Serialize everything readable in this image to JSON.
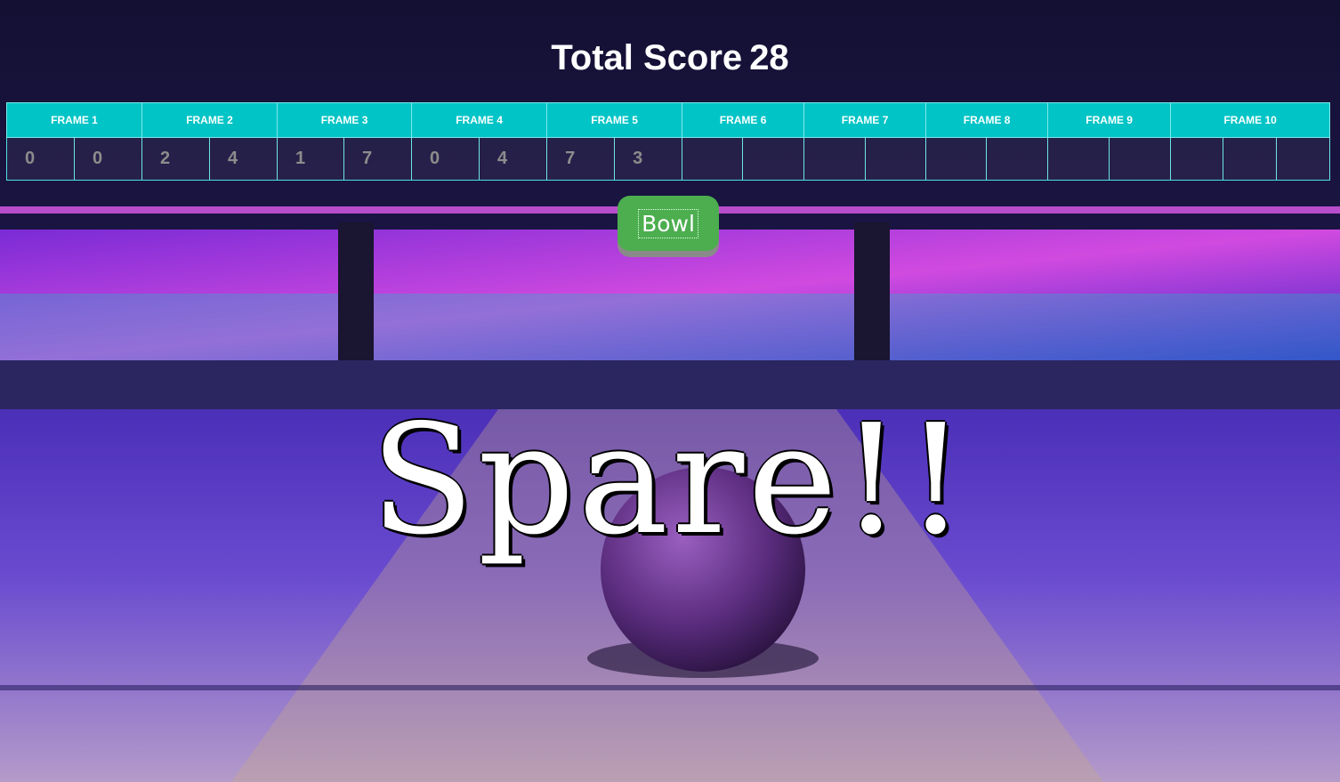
{
  "header": {
    "total_label": "Total Score",
    "total_value": "28"
  },
  "scoreboard": {
    "frames": [
      "FRAME 1",
      "FRAME 2",
      "FRAME 3",
      "FRAME 4",
      "FRAME 5",
      "FRAME 6",
      "FRAME 7",
      "FRAME 8",
      "FRAME 9",
      "FRAME 10"
    ],
    "rolls": [
      "0",
      "0",
      "2",
      "4",
      "1",
      "7",
      "0",
      "4",
      "7",
      "3",
      "",
      "",
      "",
      "",
      "",
      "",
      "",
      "",
      "",
      "",
      "",
      ""
    ]
  },
  "controls": {
    "bowl_label": "Bowl"
  },
  "message": {
    "text": "Spare!!"
  },
  "colors": {
    "header_cell": "#00c4c6",
    "bowl_button": "#4cae4f"
  }
}
